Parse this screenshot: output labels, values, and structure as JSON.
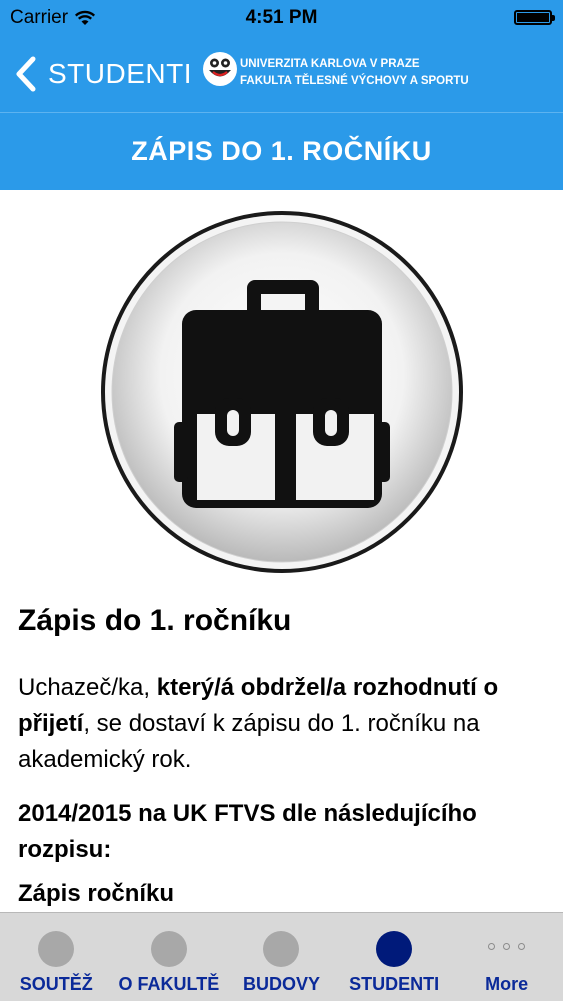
{
  "status_bar": {
    "carrier": "Carrier",
    "time": "4:51 PM"
  },
  "nav": {
    "back_label": "STUDENTI",
    "university_line1": "UNIVERZITA KARLOVA V PRAZE",
    "university_line2": "FAKULTA TĚLESNÉ VÝCHOVY A SPORTU"
  },
  "page_title": "ZÁPIS DO 1. ROČNÍKU",
  "hero_icon": "backpack-icon",
  "article": {
    "heading": "Zápis do 1. ročníku",
    "p1_a": "Uchazeč/ka, ",
    "p1_b": "který/á obdržel/a rozhodnutí o přijetí",
    "p1_c": ", se dostaví k zápisu do 1. ročníku na akademický rok.",
    "p2": "2014/2015 na UK FTVS dle následujícího rozpisu:",
    "p3": "Zápis ročníku"
  },
  "tabs": [
    {
      "label": "SOUTĚŽ",
      "active": false
    },
    {
      "label": "O FAKULTĚ",
      "active": false
    },
    {
      "label": "BUDOVY",
      "active": false
    },
    {
      "label": "STUDENTI",
      "active": true
    },
    {
      "label": "More",
      "active": false
    }
  ],
  "colors": {
    "header_blue": "#2b9ae9",
    "tab_active": "#001a7a",
    "tab_label": "#0b2a99"
  }
}
